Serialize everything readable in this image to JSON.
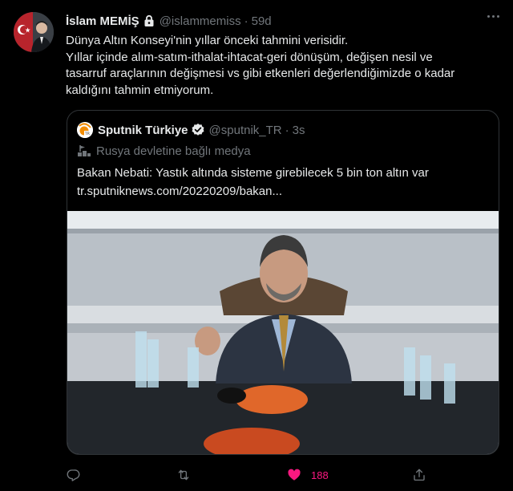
{
  "tweet": {
    "author": {
      "display_name": "İslam MEMİŞ",
      "handle": "@islammemiss",
      "protected_icon": "lock-icon"
    },
    "separator": "·",
    "time": "59d",
    "text_lines": [
      "Dünya Altın Konseyi'nin yıllar önceki tahmini verisidir.",
      "Yıllar içinde alım-satım-ithalat-ihtacat-geri dönüşüm, değişen nesil ve",
      "tasarruf araçlarının değişmesi vs gibi etkenleri değerlendiğimizde o kadar",
      "kaldığını tahmin etmiyorum."
    ],
    "quote": {
      "author": {
        "display_name": "Sputnik Türkiye",
        "handle": "@sputnik_TR",
        "verified_icon": "verified-badge-icon"
      },
      "separator": "·",
      "time": "3s",
      "state_label": "Rusya devletine bağlı medya",
      "text_lines": [
        "Bakan Nebati: Yastık altında sisteme girebilecek 5 bin ton altın var",
        "tr.sputniknews.com/20220209/bakan..."
      ]
    },
    "actions": {
      "reply_icon": "reply-icon",
      "retweet_icon": "retweet-icon",
      "like_icon": "heart-filled-icon",
      "like_count": "188",
      "share_icon": "share-icon"
    }
  },
  "colors": {
    "background": "#000000",
    "text_primary": "#e7e9ea",
    "text_secondary": "#71767b",
    "border": "#2f3336",
    "like": "#f91880"
  }
}
